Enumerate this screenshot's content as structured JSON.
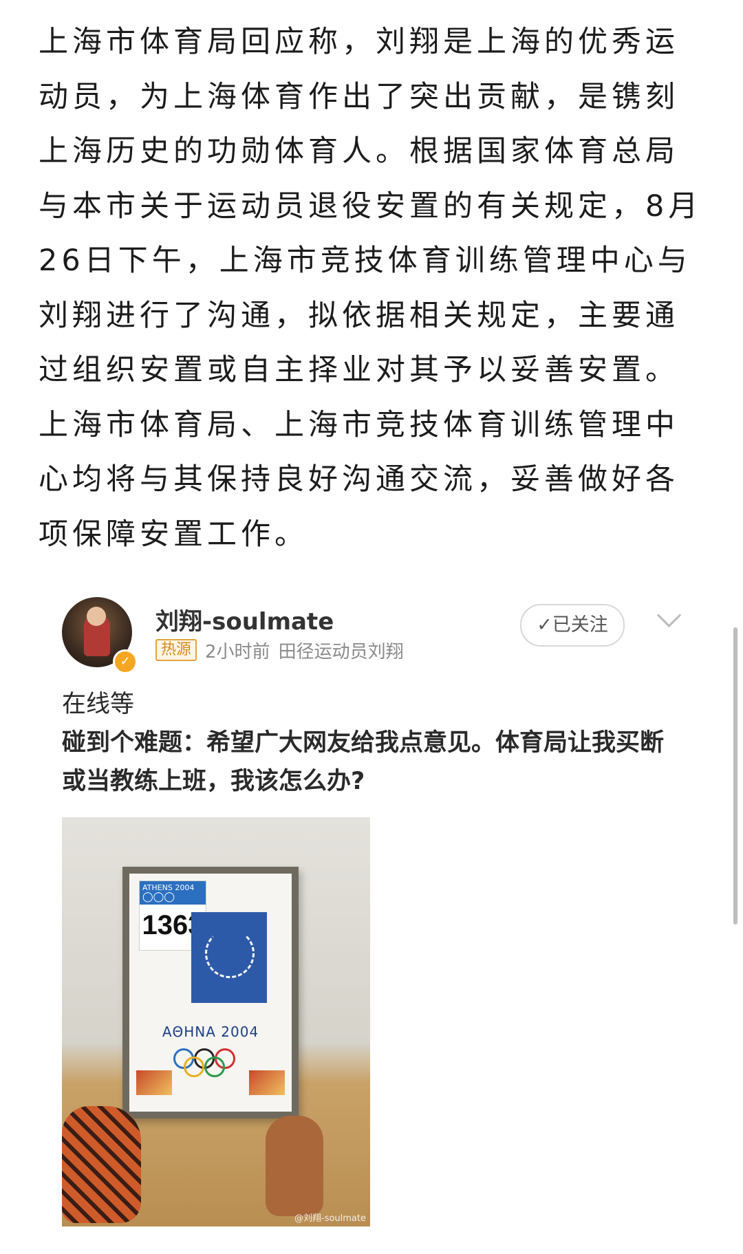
{
  "article": {
    "paragraph": "上海市体育局回应称，刘翔是上海的优秀运动员，为上海体育作出了突出贡献，是镌刻上海历史的功勋体育人。根据国家体育总局与本市关于运动员退役安置的有关规定，8月26日下午，上海市竞技体育训练管理中心与刘翔进行了沟通，拟依据相关规定，主要通过组织安置或自主择业对其予以妥善安置。上海市体育局、上海市竞技体育训练管理中心均将与其保持良好沟通交流，妥善做好各项保障安置工作。"
  },
  "post": {
    "user_name": "刘翔-soulmate",
    "source_badge": "热源",
    "time": "2小时前",
    "bio": "田径运动员刘翔",
    "follow_label": "✓已关注",
    "text_line1": "在线等",
    "text_line2": "碰到个难题：希望广大网友给我点意见。体育局让我买断或当教练上班，我该怎么办?",
    "photo": {
      "bib_header": "ATHENS 2004",
      "bib_number": "1363",
      "poster_caption": "ΑΘΗΝΑ 2004",
      "watermark": "@刘翔-soulmate"
    }
  },
  "colors": {
    "badge": "#e8a23a",
    "poster_blue": "#2d5aa8",
    "text": "#1c1c1c"
  }
}
